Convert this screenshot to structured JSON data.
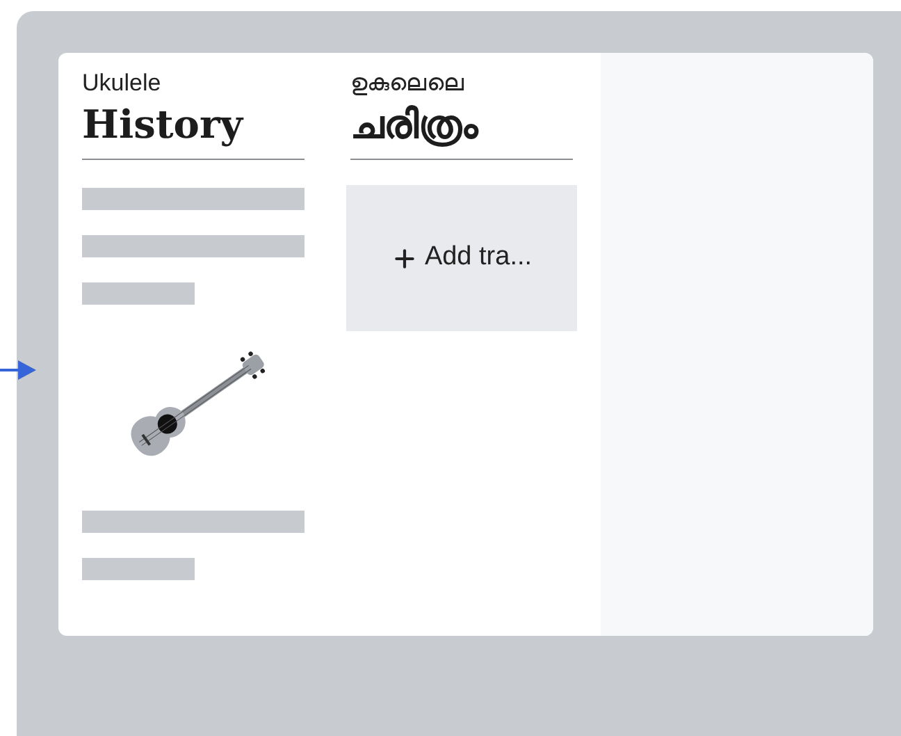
{
  "columns": [
    {
      "subtitle": "Ukulele",
      "title": "History",
      "items": [
        {
          "kind": "line"
        },
        {
          "kind": "line"
        },
        {
          "kind": "shortline"
        },
        {
          "kind": "illustration"
        },
        {
          "kind": "line"
        },
        {
          "kind": "shortline"
        }
      ]
    },
    {
      "subtitle": "ഉകുലെലെ",
      "title": "ചരിത്രം",
      "add_button": {
        "label": "Add tra..."
      }
    }
  ]
}
